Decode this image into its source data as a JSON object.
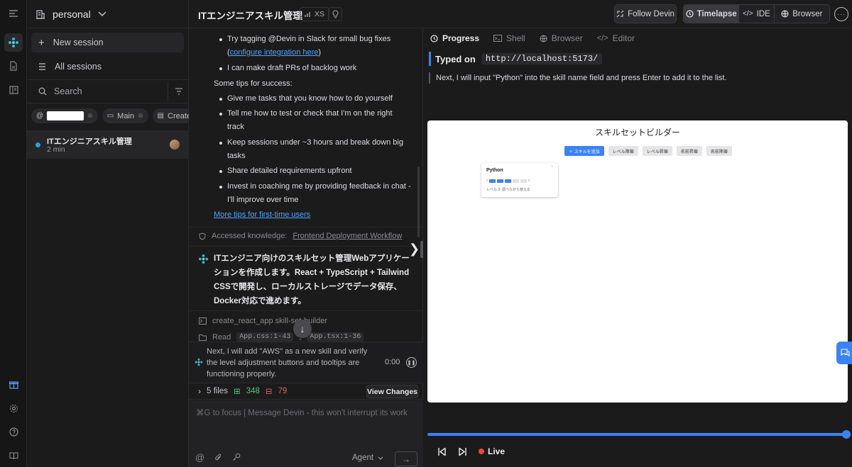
{
  "workspace": {
    "name": "personal"
  },
  "sidebar": {
    "new_session": "New session",
    "all_sessions": "All sessions",
    "search_placeholder": "Search",
    "chips": [
      {
        "label": "Main"
      },
      {
        "label": "Created"
      }
    ],
    "sessions": [
      {
        "title": "ITエンジニアスキル管理",
        "time": "2 min"
      }
    ]
  },
  "header": {
    "title": "ITエンジニアスキル管理",
    "size_badge": "XS",
    "follow": "Follow Devin",
    "views": [
      {
        "label": "Timelapse"
      },
      {
        "label": "IDE"
      },
      {
        "label": "Browser"
      }
    ],
    "active_view": "Timelapse",
    "more": "···"
  },
  "chat": {
    "bullet1_line1": "Try tagging @Devin in Slack for small bug fixes",
    "bullet1_open": "(",
    "bullet1_link": "configure integration here",
    "bullet1_close": ")",
    "bullet2": "I can make draft PRs of backlog work",
    "tips_heading": "Some tips for success:",
    "tip1": "Give me tasks that you know how to do yourself",
    "tip2_line1": "Tell me how to test or check that I'm on the right",
    "tip2_line2": "track",
    "tip3_line1": "Keep sessions under ~3 hours and break down big",
    "tip3_line2": "tasks",
    "tip4": "Share detailed requirements upfront",
    "tip5_line1": "Invest in coaching me by providing feedback in chat -",
    "tip5_line2": "I'll improve over time",
    "more_tips": "More tips for first-time users",
    "knowledge_label": "Accessed knowledge:",
    "knowledge_link": "Frontend Deployment Workflow",
    "devin_message": "ITエンジニア向けのスキルセット管理Webアプリケーションを作成します。React + TypeScript + Tailwind CSSで開発し、ローカルストレージでデータ保存、Docker対応で進めます。",
    "action1": "create_react_app skill-set-builder",
    "action2_label": "Read",
    "action2_chip1": "App.css:1-43",
    "action2_sep": ",",
    "action2_chip2": "App.tsx:1-36",
    "status_text": "Next, I will add \"AWS\" as a new skill and verify the level adjustment buttons and tooltips are functioning properly.",
    "status_time": "0:00",
    "files_count": "5 files",
    "additions": "348",
    "deletions": "79",
    "view_changes": "View Changes",
    "input_placeholder": "⌘G to focus | Message Devin - this won't interrupt its work",
    "agent_label": "Agent"
  },
  "right": {
    "tabs": [
      {
        "label": "Progress"
      },
      {
        "label": "Shell"
      },
      {
        "label": "Browser"
      },
      {
        "label": "Editor"
      }
    ],
    "typed_label": "Typed on",
    "typed_url": "http://localhost:5173/",
    "next_step": "Next, I will input \"Python\" into the skill name field and press Enter to add it to the list.",
    "live_label": "Live",
    "progress_fraction": 1.0
  },
  "app": {
    "title": "スキルセットビルダー",
    "buttons": [
      {
        "label": "＋ スキルを追加"
      },
      {
        "label": "レベル降順"
      },
      {
        "label": "レベル昇順"
      },
      {
        "label": "名前昇順"
      },
      {
        "label": "名前降順"
      }
    ],
    "card": {
      "name": "Python",
      "level_text": "レベル 3: 調べながら使える",
      "level": 3,
      "max_level": 5,
      "close": "−"
    }
  },
  "colors": {
    "accent": "#3b82f6",
    "live": "#ef4444",
    "additions": "#4cc97a",
    "deletions": "#e45c5c"
  }
}
